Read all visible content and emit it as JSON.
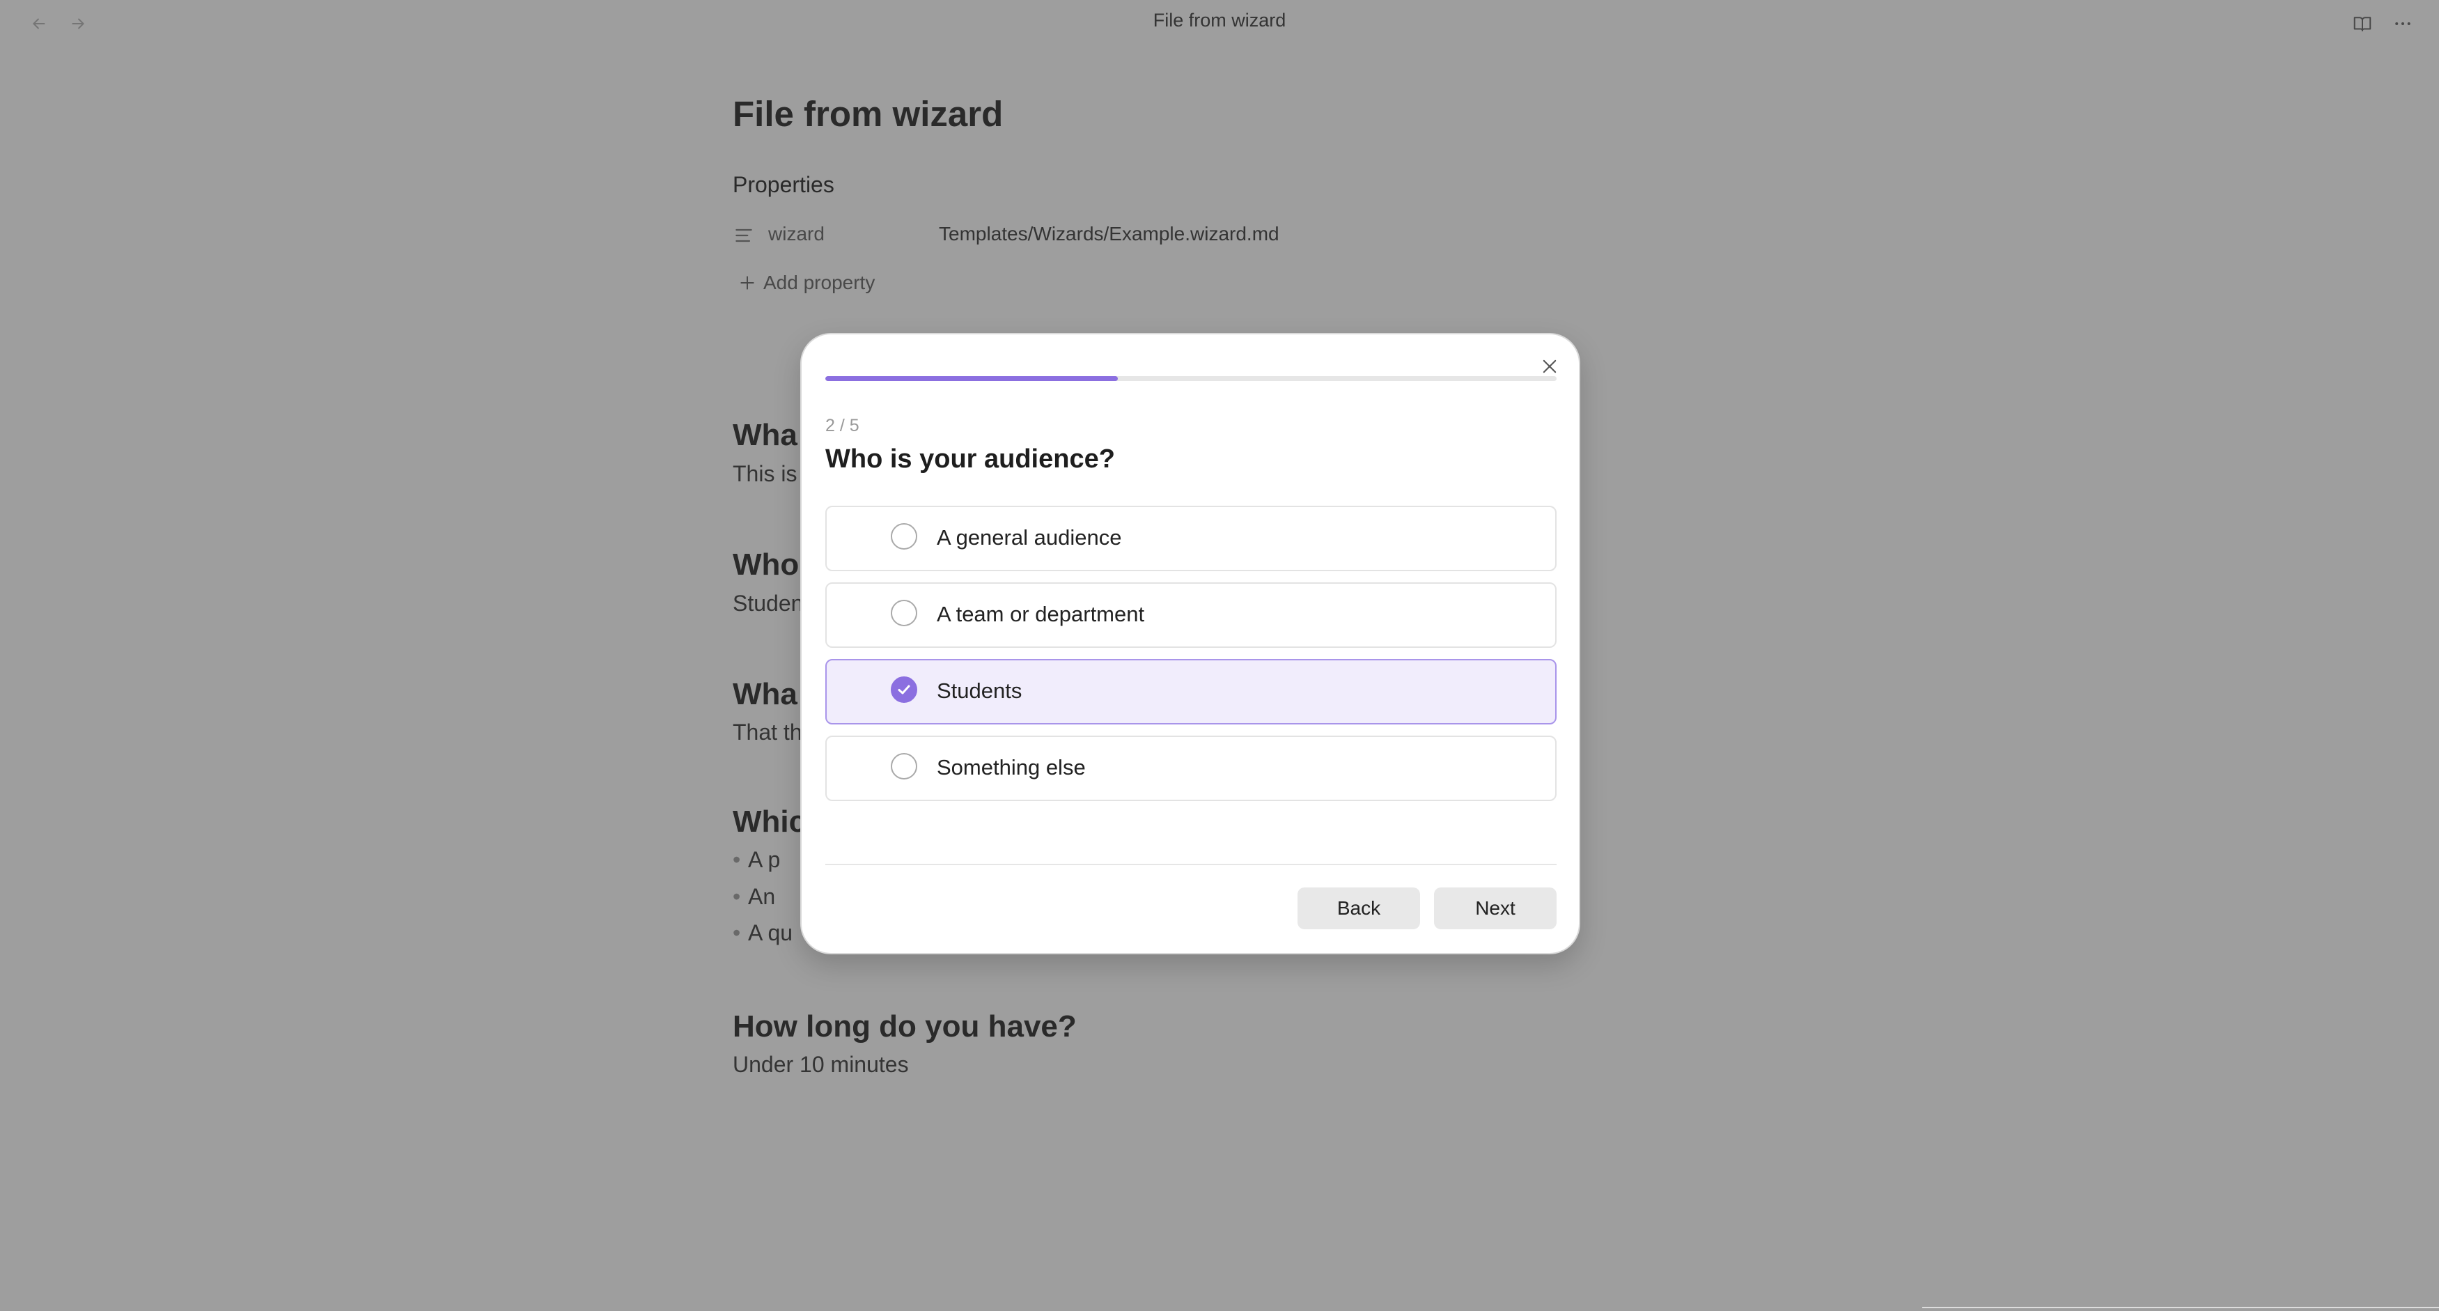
{
  "window": {
    "title": "File from wizard",
    "back_icon": "arrow-left-icon",
    "forward_icon": "arrow-right-icon",
    "reading_icon": "book-open-icon",
    "more_icon": "more-horizontal-icon"
  },
  "note": {
    "title": "File from wizard",
    "properties_heading": "Properties",
    "property": {
      "key": "wizard",
      "value": "Templates/Wizards/Example.wizard.md",
      "icon": "text-lines-icon"
    },
    "add_property_label": "Add property",
    "sections": [
      {
        "heading": "Wha",
        "text": "This is"
      },
      {
        "heading": "Who",
        "text": "Studen"
      },
      {
        "heading": "Wha",
        "text": "That th"
      },
      {
        "heading": "Whic",
        "bullets": [
          "A p",
          "An",
          "A qu"
        ]
      },
      {
        "heading": "How long do you have?",
        "text": "Under 10 minutes"
      }
    ]
  },
  "wizard": {
    "progress_fraction": 0.4,
    "step_text": "2 / 5",
    "question": "Who is your audience?",
    "options": [
      {
        "label": "A general audience",
        "selected": false
      },
      {
        "label": "A team or department",
        "selected": false
      },
      {
        "label": "Students",
        "selected": true
      },
      {
        "label": "Something else",
        "selected": false
      }
    ],
    "back_label": "Back",
    "next_label": "Next",
    "accent_color": "#8b6fe0"
  }
}
